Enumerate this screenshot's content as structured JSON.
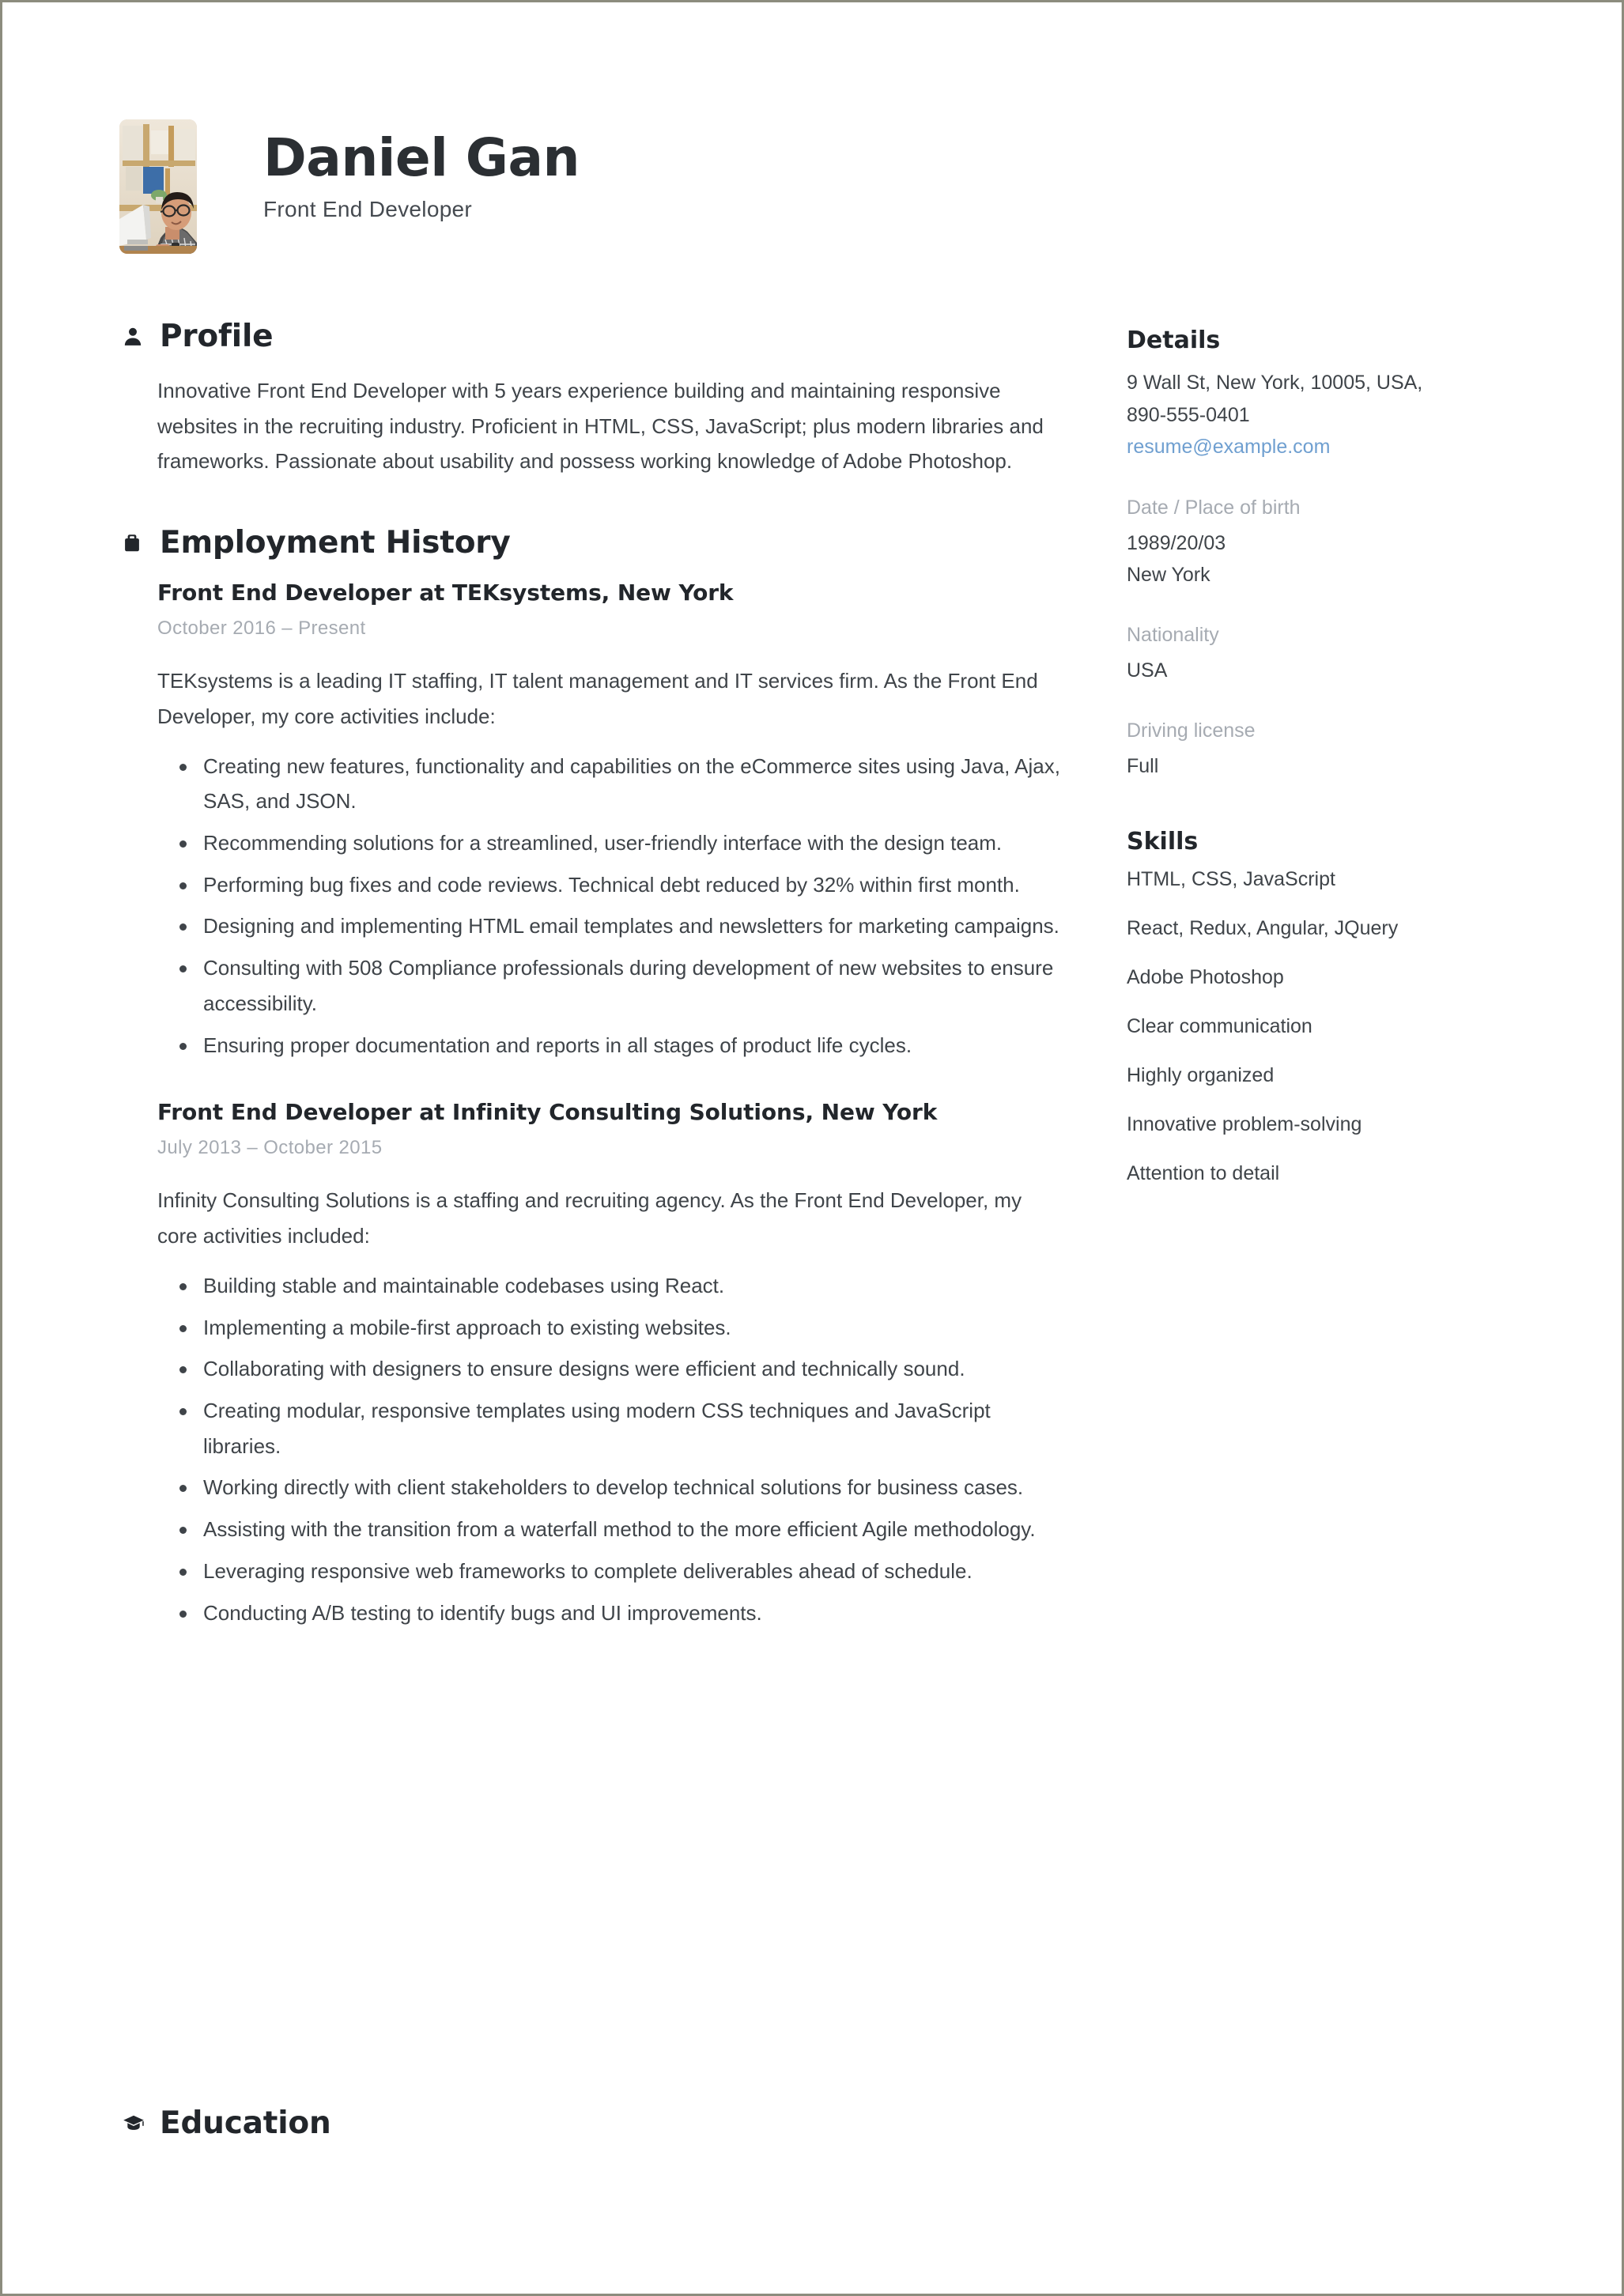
{
  "header": {
    "name": "Daniel Gan",
    "job_title": "Front End Developer",
    "avatar_alt": "portrait-photo"
  },
  "sections": {
    "profile": {
      "icon": "person-icon",
      "title": "Profile",
      "text": "Innovative Front End Developer with 5 years experience building and maintaining responsive websites in the recruiting industry. Proficient in HTML, CSS, JavaScript; plus modern libraries and frameworks. Passionate about usability and possess working knowledge of Adobe Photoshop."
    },
    "employment": {
      "icon": "briefcase-icon",
      "title": "Employment History",
      "jobs": [
        {
          "heading": "Front End Developer at TEKsystems, New York",
          "dates": "October 2016  –  Present",
          "description": "TEKsystems is a leading IT staffing, IT talent management and IT services firm. As the Front End Developer, my core activities include:",
          "bullets": [
            "Creating new features, functionality and capabilities on the eCommerce sites using Java, Ajax, SAS, and JSON.",
            "Recommending solutions for a streamlined, user-friendly interface with the design team.",
            "Performing bug fixes and code reviews. Technical debt reduced by 32% within first month.",
            "Designing and implementing HTML email templates and newsletters for marketing campaigns.",
            "Consulting with 508 Compliance professionals during development of new websites to ensure accessibility.",
            "Ensuring proper documentation and reports in all stages of product life cycles."
          ]
        },
        {
          "heading": "Front End Developer at Infinity Consulting Solutions, New York",
          "dates": "July 2013  –  October 2015",
          "description": "Infinity Consulting Solutions is a staffing and recruiting agency. As the Front End Developer, my core activities included:",
          "bullets": [
            "Building stable and maintainable codebases using React.",
            "Implementing a mobile-first approach to existing websites.",
            "Collaborating with designers to ensure designs were efficient and technically sound.",
            "Creating modular, responsive templates using modern CSS techniques and JavaScript libraries.",
            "Working directly with client stakeholders to develop technical solutions for business cases.",
            "Assisting with the transition from a waterfall method to the more efficient Agile methodology.",
            "Leveraging responsive web frameworks to complete deliverables ahead of schedule.",
            "Conducting A/B testing to identify bugs and UI improvements."
          ]
        }
      ]
    },
    "education": {
      "icon": "graduation-cap-icon",
      "title": "Education"
    }
  },
  "sidebar": {
    "details": {
      "title": "Details",
      "address": "9 Wall St, New York, 10005, USA,",
      "phone": "890-555-0401",
      "email": "resume@example.com",
      "groups": [
        {
          "label": "Date / Place of birth",
          "value_line1": "1989/20/03",
          "value_line2": "New York"
        },
        {
          "label": "Nationality",
          "value_line1": "USA",
          "value_line2": ""
        },
        {
          "label": "Driving license",
          "value_line1": "Full",
          "value_line2": ""
        }
      ]
    },
    "skills": {
      "title": "Skills",
      "items": [
        "HTML, CSS, JavaScript",
        "React, Redux, Angular, JQuery",
        "Adobe Photoshop",
        "Clear communication",
        "Highly organized",
        "Innovative problem-solving",
        "Attention to detail"
      ]
    }
  },
  "colors": {
    "text": "#3f4449",
    "heading": "#22262b",
    "muted": "#a6abb2",
    "link": "#6f9fd0",
    "page_border": "#8c8c7e"
  }
}
